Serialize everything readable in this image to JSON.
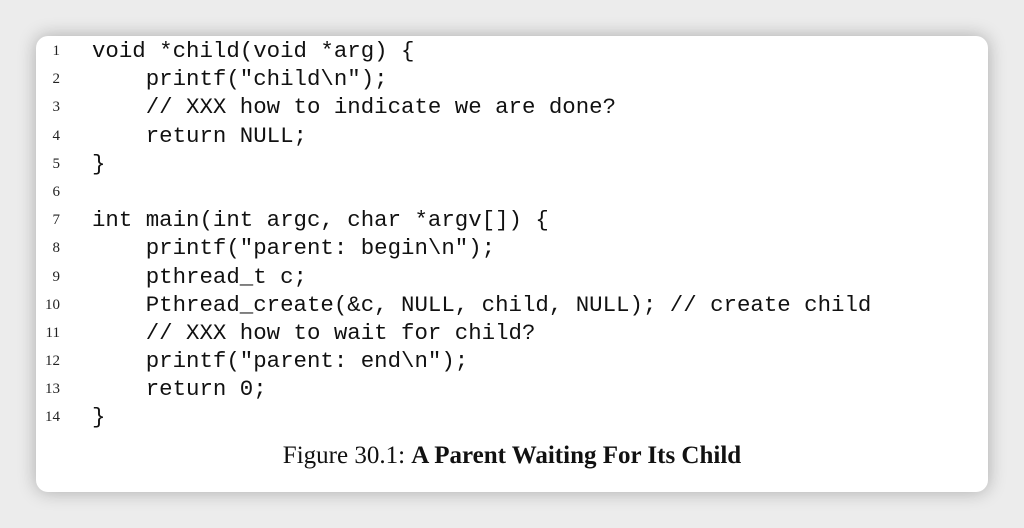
{
  "code_lines": [
    {
      "n": "1",
      "text": "void *child(void *arg) {"
    },
    {
      "n": "2",
      "text": "    printf(\"child\\n\");"
    },
    {
      "n": "3",
      "text": "    // XXX how to indicate we are done?"
    },
    {
      "n": "4",
      "text": "    return NULL;"
    },
    {
      "n": "5",
      "text": "}"
    },
    {
      "n": "6",
      "text": ""
    },
    {
      "n": "7",
      "text": "int main(int argc, char *argv[]) {"
    },
    {
      "n": "8",
      "text": "    printf(\"parent: begin\\n\");"
    },
    {
      "n": "9",
      "text": "    pthread_t c;"
    },
    {
      "n": "10",
      "text": "    Pthread_create(&c, NULL, child, NULL); // create child"
    },
    {
      "n": "11",
      "text": "    // XXX how to wait for child?"
    },
    {
      "n": "12",
      "text": "    printf(\"parent: end\\n\");"
    },
    {
      "n": "13",
      "text": "    return 0;"
    },
    {
      "n": "14",
      "text": "}"
    }
  ],
  "caption": {
    "label": "Figure 30.1:",
    "title": "A Parent Waiting For Its Child"
  }
}
